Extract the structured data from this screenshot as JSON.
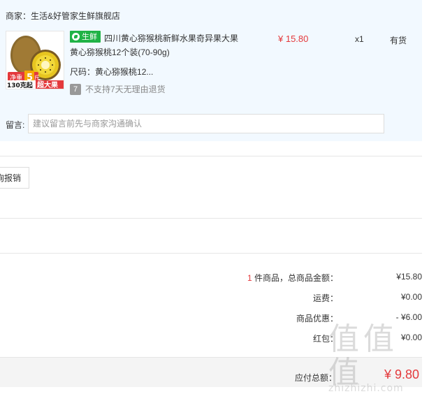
{
  "shop": {
    "label": "商家：",
    "name": "生活&好管家生鲜旗舰店"
  },
  "product": {
    "tag": "生鲜",
    "title": "四川黄心猕猴桃新鲜水果奇异果大果 黄心猕猴桃12个装(70-90g)",
    "spec_label": "尺码：",
    "spec_value": "黄心猕猴桃12...",
    "return_icon": "7",
    "return_policy": "不支持7天无理由退货",
    "price": "¥ 15.80",
    "quantity": "x1",
    "stock": "有货",
    "image": {
      "weight_badge": "净重",
      "weight_num": "5",
      "weight_unit": "斤",
      "count_text": "130克起",
      "big_text": "超大果"
    }
  },
  "message": {
    "label": "留言:",
    "placeholder": "建议留言前先与商家沟通确认"
  },
  "report_button": "询报销",
  "summary": {
    "count": "1",
    "count_suffix": " 件商品，总商品金额：",
    "goods_total": "¥15.80",
    "shipping_label": "运费：",
    "shipping_value": "¥0.00",
    "discount_label": "商品优惠：",
    "discount_value": "- ¥6.00",
    "redpacket_label": "红包：",
    "redpacket_value": "¥0.00"
  },
  "total": {
    "label": "应付总额：",
    "value": "¥ 9.80"
  },
  "watermark": {
    "glyphs": "值值值",
    "sub": "zhizhizhi.com"
  },
  "colors": {
    "accent_red": "#e4393c",
    "fresh_green": "#1fb246",
    "panel_bg": "#f2f9ff"
  }
}
